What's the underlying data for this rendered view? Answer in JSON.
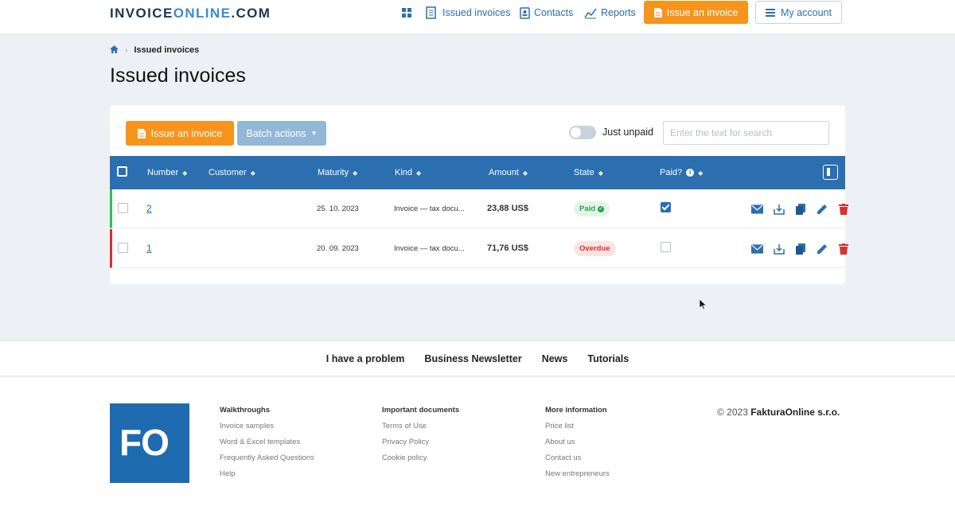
{
  "header": {
    "logo_main": "INVOICE",
    "logo_accent": "ONLINE",
    "logo_suffix": ".COM",
    "nav": {
      "issued_invoices": "Issued invoices",
      "contacts": "Contacts",
      "reports": "Reports"
    },
    "issue_button": "Issue an invoice",
    "account_button": "My account"
  },
  "breadcrumb": {
    "current": "Issued invoices"
  },
  "page_title": "Issued invoices",
  "toolbar": {
    "issue_button": "Issue an invoice",
    "batch_button": "Batch actions",
    "toggle_label": "Just unpaid",
    "toggle_on": false,
    "search_placeholder": "Enter the text for search"
  },
  "table": {
    "columns": {
      "number": "Number",
      "customer": "Customer",
      "maturity": "Maturity",
      "kind": "Kind",
      "amount": "Amount",
      "state": "State",
      "paid": "Paid?"
    },
    "rows": [
      {
        "number": "2",
        "customer": "",
        "maturity": "25. 10. 2023",
        "kind": "Invoice — tax docu...",
        "amount": "23,88 US$",
        "state": "Paid",
        "paid": true
      },
      {
        "number": "1",
        "customer": "",
        "maturity": "20. 09. 2023",
        "kind": "Invoice — tax docu...",
        "amount": "71,76 US$",
        "state": "Overdue",
        "paid": false
      }
    ]
  },
  "footer_nav": {
    "problem": "I have a problem",
    "newsletter": "Business Newsletter",
    "news": "News",
    "tutorials": "Tutorials"
  },
  "footer": {
    "logo_text": "FO",
    "walkthroughs": {
      "title": "Walkthroughs",
      "links": [
        "Invoice samples",
        "Word & Excel templates",
        "Frequently Asked Questions",
        "Help"
      ]
    },
    "documents": {
      "title": "Important documents",
      "links": [
        "Terms of Use",
        "Privacy Policy",
        "Cookie policy"
      ]
    },
    "more": {
      "title": "More information",
      "links": [
        "Price list",
        "About us",
        "Contact us",
        "New entrepreneurs"
      ]
    },
    "copyright_prefix": "© 2023 ",
    "copyright_company": "FakturaOnline s.r.o."
  },
  "colors": {
    "brand_blue": "#2b6fb0",
    "accent_orange": "#f7941d",
    "paid_green": "#2ebd5a",
    "overdue_red": "#d7302f"
  }
}
